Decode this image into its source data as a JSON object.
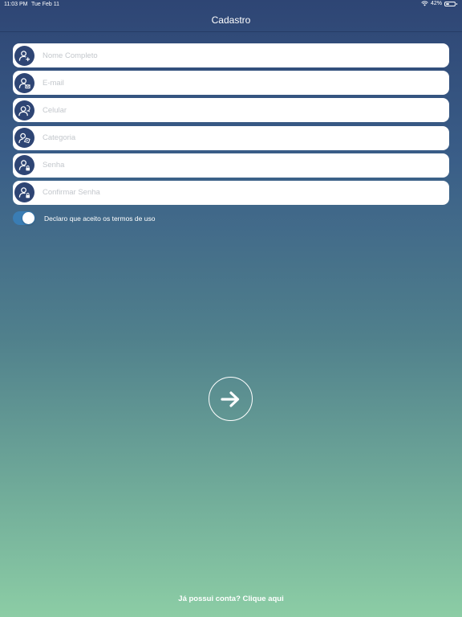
{
  "status_bar": {
    "time": "11:03 PM",
    "date": "Tue Feb 11",
    "battery_percent": "42%",
    "battery_level": 0.42
  },
  "nav": {
    "title": "Cadastro"
  },
  "form": {
    "fields": [
      {
        "placeholder": "Nome Completo",
        "icon": "user-add-icon",
        "value": ""
      },
      {
        "placeholder": "E-mail",
        "icon": "user-email-icon",
        "value": ""
      },
      {
        "placeholder": "Celular",
        "icon": "user-phone-icon",
        "value": ""
      },
      {
        "placeholder": "Categoria",
        "icon": "user-category-icon",
        "value": ""
      },
      {
        "placeholder": "Senha",
        "icon": "user-lock-icon",
        "value": ""
      },
      {
        "placeholder": "Confirmar Senha",
        "icon": "user-lock-icon",
        "value": ""
      }
    ]
  },
  "terms": {
    "label": "Declaro que aceito os termos de uso",
    "accepted": true
  },
  "next_button": {
    "icon": "arrow-right-icon"
  },
  "login_link": {
    "label": "Já possui conta? Clique aqui"
  },
  "colors": {
    "accent": "#2e4574",
    "toggle_on": "#3a7db4",
    "gradient_top": "#2e4574",
    "gradient_bottom": "#8ccda5"
  }
}
